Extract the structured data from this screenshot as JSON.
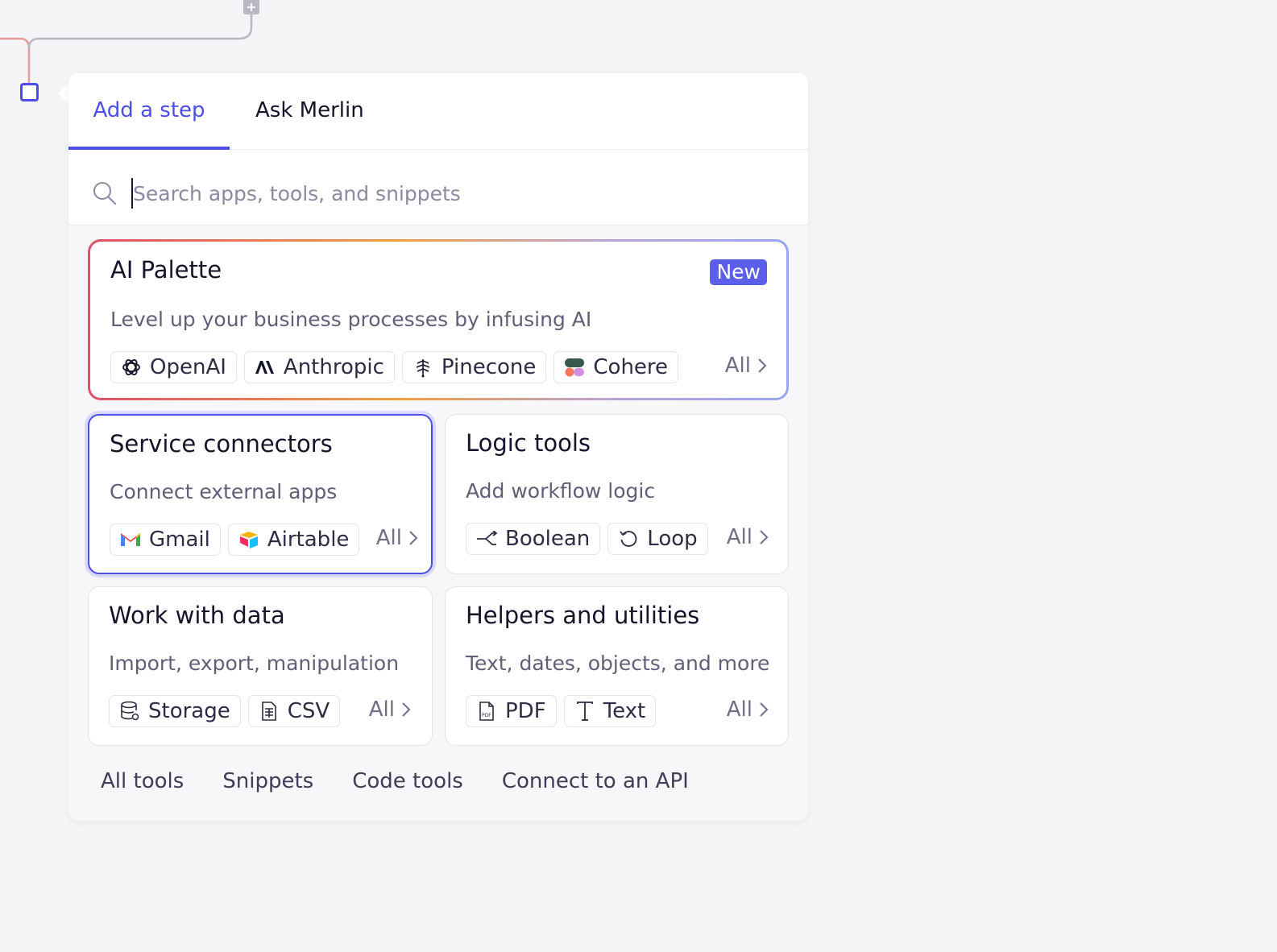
{
  "tabs": [
    {
      "label": "Add a step",
      "active": true
    },
    {
      "label": "Ask Merlin",
      "active": false
    }
  ],
  "search": {
    "placeholder": "Search apps, tools, and snippets",
    "value": ""
  },
  "ai_palette": {
    "title": "AI Palette",
    "badge": "New",
    "description": "Level up your business processes by infusing AI",
    "chips": [
      "OpenAI",
      "Anthropic",
      "Pinecone",
      "Cohere"
    ],
    "all_label": "All"
  },
  "service_connectors": {
    "title": "Service connectors",
    "description": "Connect external apps",
    "chips": [
      "Gmail",
      "Airtable"
    ],
    "all_label": "All"
  },
  "logic_tools": {
    "title": "Logic tools",
    "description": "Add workflow logic",
    "chips": [
      "Boolean",
      "Loop"
    ],
    "all_label": "All"
  },
  "work_with_data": {
    "title": "Work with data",
    "description": "Import, export, manipulation",
    "chips": [
      "Storage",
      "CSV"
    ],
    "all_label": "All"
  },
  "helpers": {
    "title": "Helpers and utilities",
    "description": "Text, dates, objects, and more",
    "chips": [
      "PDF",
      "Text"
    ],
    "all_label": "All"
  },
  "footer_links": [
    "All tools",
    "Snippets",
    "Code tools",
    "Connect to an API"
  ],
  "colors": {
    "accent": "#4b4ee8",
    "badge": "#5b5ee9"
  },
  "icons": {
    "openai": "openai-logo-icon",
    "anthropic": "anthropic-logo-icon",
    "pinecone": "pinecone-logo-icon",
    "cohere": "cohere-logo-icon",
    "gmail": "gmail-logo-icon",
    "airtable": "airtable-logo-icon",
    "boolean": "branch-icon",
    "loop": "loop-icon",
    "storage": "database-icon",
    "csv": "document-icon",
    "pdf": "pdf-file-icon",
    "text": "text-t-icon"
  }
}
